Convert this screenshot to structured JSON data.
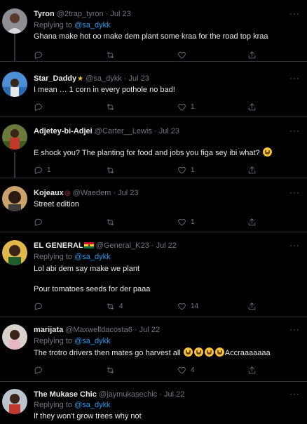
{
  "tweets": [
    {
      "name": "Tyron",
      "badge": "",
      "handle": "@2trap_tyron",
      "date": "Jul 23",
      "replying_prefix": "Replying to",
      "replying_to": "@sa_dykk",
      "lines": [
        "Ghana make hot oo make dem plant some kraa for the road top kraa"
      ],
      "replies": "",
      "retweets": "",
      "likes": ""
    },
    {
      "name": "Star_Daddy",
      "badge": "★",
      "handle": "@sa_dykk",
      "date": "Jul 23",
      "replying_prefix": "",
      "replying_to": "",
      "lines": [
        "I mean … 1 corn in every pothole no bad!"
      ],
      "replies": "",
      "retweets": "",
      "likes": "1"
    },
    {
      "name": "Adjetey-bi-Adjei",
      "badge": "",
      "handle": "@Carter__Lewis",
      "date": "Jul 23",
      "replying_prefix": "",
      "replying_to": "",
      "lines": [
        "E shock you? The planting for food and jobs you figa sey ibi what?"
      ],
      "replies": "1",
      "retweets": "",
      "likes": "1"
    },
    {
      "name": "Kojeaux",
      "badge": "◎",
      "handle": "@Waedem",
      "date": "Jul 23",
      "replying_prefix": "",
      "replying_to": "",
      "lines": [
        "Street edition"
      ],
      "replies": "",
      "retweets": "",
      "likes": "1"
    },
    {
      "name": "EL GENERAL",
      "badge": "",
      "handle": "@General_K23",
      "date": "Jul 22",
      "replying_prefix": "Replying to",
      "replying_to": "@sa_dykk",
      "lines": [
        "Lol abi dem say make we plant",
        "",
        "Pour tomatoes seeds for der paaa"
      ],
      "replies": "",
      "retweets": "4",
      "likes": "14"
    },
    {
      "name": "marijata",
      "badge": "",
      "handle": "@Maxwelldacosta6",
      "date": "Jul 22",
      "replying_prefix": "Replying to",
      "replying_to": "@sa_dykk",
      "lines": [
        "The trotro drivers then mates go harvest all"
      ],
      "trailing_text": "Accraaaaaaa",
      "replies": "",
      "retweets": "",
      "likes": "4"
    },
    {
      "name": "The Mukase Chic",
      "badge": "",
      "handle": "@jaymukasechic",
      "date": "Jul 22",
      "replying_prefix": "Replying to",
      "replying_to": "@sa_dykk",
      "lines": [
        "If they won't grow trees why not"
      ],
      "replies": "",
      "retweets": "",
      "likes": ""
    }
  ],
  "more_label": "···",
  "dot": "·",
  "colors": {
    "background": "#000000",
    "text": "#e7e9ea",
    "muted": "#71767b",
    "accent": "#1d9bf0",
    "divider": "#2f3336"
  },
  "icons": {
    "reply": "comment-icon",
    "retweet": "retweet-icon",
    "like": "heart-icon",
    "share": "share-icon",
    "more": "more-icon"
  }
}
